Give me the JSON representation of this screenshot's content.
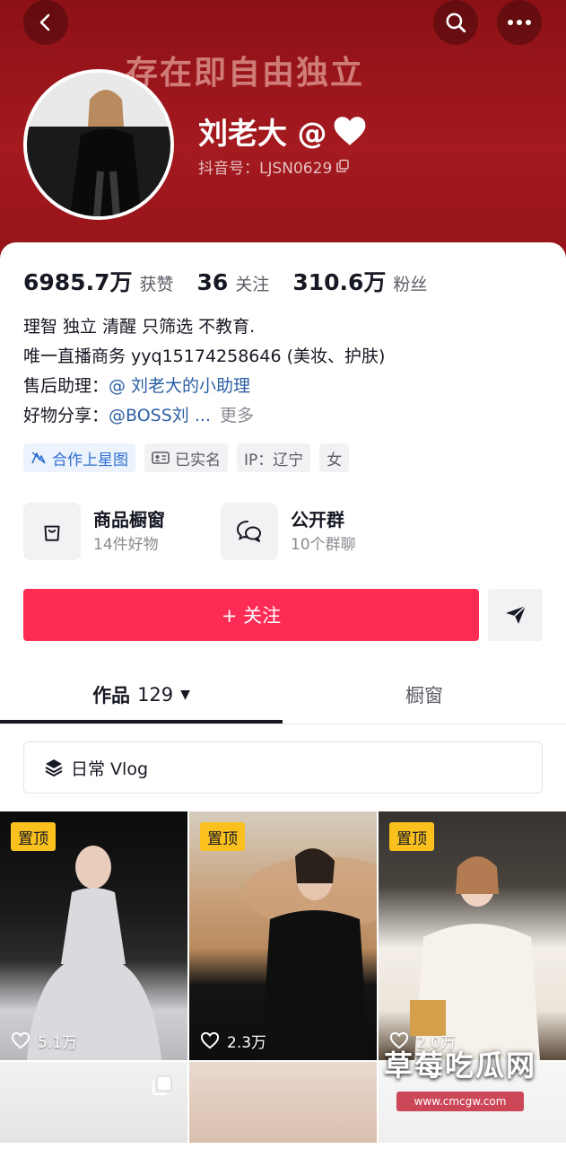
{
  "banner": {
    "slogan": "存在即自由独立"
  },
  "profile": {
    "nickname": "刘老大 @",
    "douyin_id": "抖音号：LJSN0629"
  },
  "stats": [
    {
      "value": "6985.7万",
      "label": "获赞"
    },
    {
      "value": "36",
      "label": "关注"
    },
    {
      "value": "310.6万",
      "label": "粉丝"
    }
  ],
  "bio": {
    "line1": "理智 独立 清醒 只筛选 不教育.",
    "line2": "唯一直播商务 yyq15174258646 (美妆、护肤)",
    "line3_prefix": "售后助理：",
    "line3_link": "@ 刘老大的小助理",
    "line4_prefix": "好物分享：",
    "line4_link": "@BOSS刘 ...",
    "more": "更多"
  },
  "tags": {
    "xingtu": "合作上星图",
    "verified": "已实名",
    "ip": "IP：辽宁",
    "gender": "女"
  },
  "entries": {
    "shop_title": "商品橱窗",
    "shop_sub": "14件好物",
    "group_title": "公开群",
    "group_sub": "10个群聊"
  },
  "actions": {
    "follow": "+ 关注"
  },
  "tabs": {
    "works_label": "作品",
    "works_count": "129",
    "window_label": "橱窗"
  },
  "collection": {
    "label": "日常 Vlog"
  },
  "videos": [
    {
      "pinned": "置顶",
      "likes": "5.1万"
    },
    {
      "pinned": "置顶",
      "likes": "2.3万"
    },
    {
      "pinned": "置顶",
      "likes": "2.0万"
    }
  ],
  "watermark": {
    "title": "草莓吃瓜网",
    "url": "www.cmcgw.com"
  },
  "colors": {
    "banner": "#a41a1f",
    "follow_button": "#fe2c55",
    "link": "#2d5fa6",
    "pin_badge": "#fac01e"
  }
}
